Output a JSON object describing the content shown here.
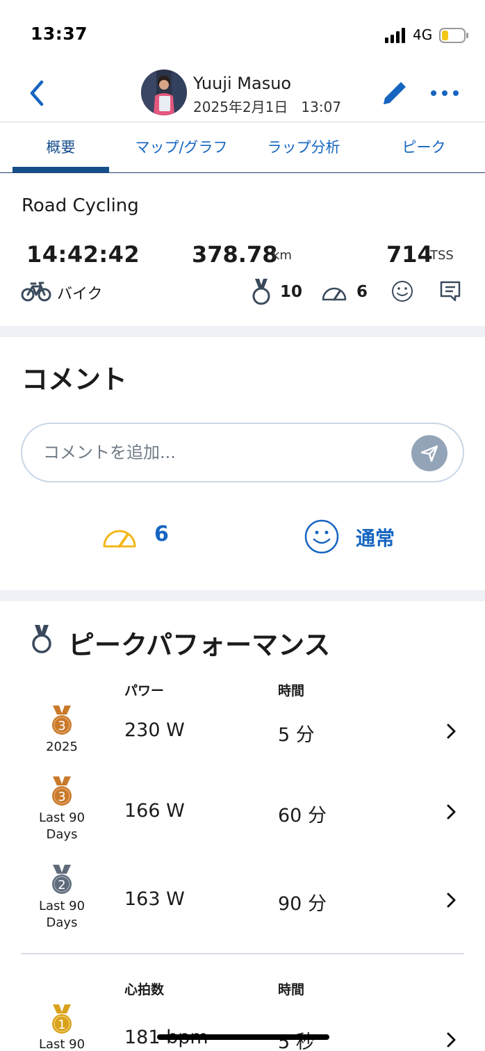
{
  "status_bar": {
    "time": "13:37",
    "network": "4G",
    "battery_color": "#f5c518"
  },
  "header": {
    "user_name": "Yuuji Masuo",
    "datetime": "2025年2月1日   13:07"
  },
  "tabs": [
    {
      "label": "概要",
      "active": true
    },
    {
      "label": "マップ/グラフ",
      "active": false
    },
    {
      "label": "ラップ分析",
      "active": false
    },
    {
      "label": "ピーク",
      "active": false
    }
  ],
  "summary": {
    "title": "Road Cycling",
    "duration": "14:42:42",
    "distance": "378.78",
    "distance_unit": "km",
    "tss": "714",
    "tss_unit": "TSS",
    "sport": "バイク",
    "medal_count": "10",
    "rpe_count": "6"
  },
  "comments": {
    "title": "コメント",
    "input_value": "",
    "placeholder": "コメントを追加...",
    "rpe_value": "6",
    "feel_value": "通常"
  },
  "peaks": {
    "title": "ピークパフォーマンス",
    "power_group": {
      "col_value": "パワー",
      "col_time": "時間",
      "rows": [
        {
          "rank": "3",
          "medal": "bronze",
          "label": "2025",
          "value": "230 W",
          "time": "5 分"
        },
        {
          "rank": "3",
          "medal": "bronze",
          "label": "Last 90 Days",
          "value": "166 W",
          "time": "60 分"
        },
        {
          "rank": "2",
          "medal": "silver",
          "label": "Last 90 Days",
          "value": "163 W",
          "time": "90 分"
        }
      ]
    },
    "hr_group": {
      "col_value": "心拍数",
      "col_time": "時間",
      "rows": [
        {
          "rank": "1",
          "medal": "gold",
          "label": "Last 90",
          "value": "181 bpm",
          "time": "5 秒"
        }
      ]
    }
  },
  "colors": {
    "accent": "#1565c0",
    "tab_active": "#174e8c",
    "bronze": "#c87a2a",
    "silver": "#5f6b7a",
    "gold": "#d9a21c",
    "rpe_gauge": "#f2b81c"
  },
  "icons": [
    "back-icon",
    "pencil-icon",
    "more-icon",
    "bike-icon",
    "medal-icon",
    "gauge-icon",
    "smiley-icon",
    "comment-icon",
    "send-icon",
    "chevron-right-icon"
  ]
}
